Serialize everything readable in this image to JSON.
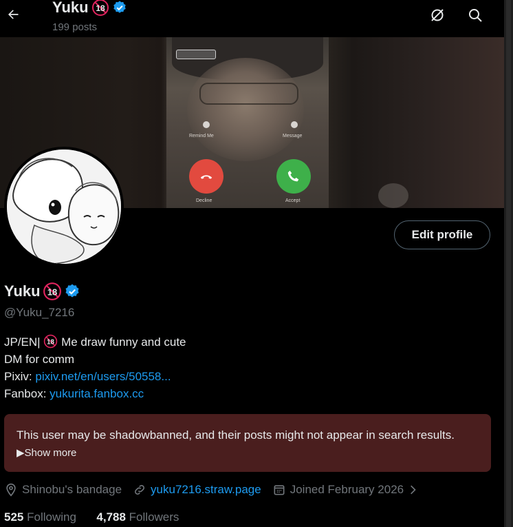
{
  "header": {
    "name": "Yuku",
    "posts_count": "199 posts"
  },
  "profile": {
    "display_name": "Yuku",
    "handle": "@Yuku_7216",
    "edit_label": "Edit profile",
    "bio": {
      "line1_prefix": "JP/EN|",
      "line1_suffix": "Me draw funny and cute",
      "line2": "DM for comm",
      "pixiv_label": "Pixiv:",
      "pixiv_link": "pixiv.net/en/users/50558...",
      "fanbox_label": "Fanbox:",
      "fanbox_link": "yukurita.fanbox.cc"
    },
    "warning": {
      "text": "This user may be shadowbanned, and their posts might not appear in search results.",
      "show_more": "▶Show more"
    },
    "location": "Shinobu's bandage",
    "website": "yuku7216.straw.page",
    "joined": "Joined February 2026",
    "following_count": "525",
    "following_label": "Following",
    "followers_count": "4,788",
    "followers_label": "Followers"
  },
  "banner": {
    "remind_me": "Remind Me",
    "message": "Message",
    "decline": "Decline",
    "accept": "Accept"
  },
  "colors": {
    "accent": "#1d9bf0",
    "warning_bg": "#4a1e1e",
    "muted": "#71767b"
  },
  "icons": [
    "back-arrow-icon",
    "verified-icon",
    "adult-18-icon",
    "grok-icon",
    "search-icon",
    "location-icon",
    "link-icon",
    "calendar-icon",
    "chevron-right-icon"
  ]
}
